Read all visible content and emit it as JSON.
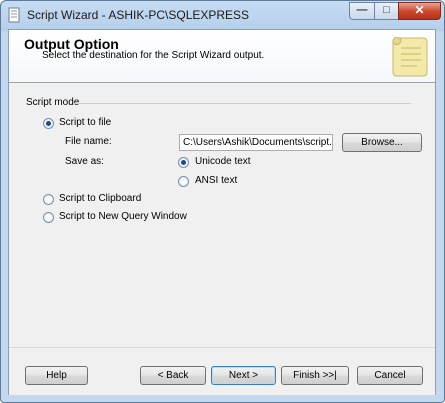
{
  "window": {
    "title": "Script Wizard - ASHIK-PC\\SQLEXPRESS",
    "minimize_glyph": "—",
    "maximize_glyph": "□",
    "close_glyph": "✕"
  },
  "header": {
    "title": "Output Option",
    "subtitle": "Select the destination for the Script Wizard output."
  },
  "script_mode": {
    "group_label": "Script mode",
    "options": [
      {
        "label": "Script to file",
        "selected": true
      },
      {
        "label": "Script to Clipboard",
        "selected": false
      },
      {
        "label": "Script to New Query Window",
        "selected": false
      }
    ],
    "file_name_label": "File name:",
    "file_name_value": "C:\\Users\\Ashik\\Documents\\script.s",
    "browse_label": "Browse...",
    "save_as_label": "Save as:",
    "save_as_options": [
      {
        "label": "Unicode text",
        "selected": true
      },
      {
        "label": "ANSI text",
        "selected": false
      }
    ]
  },
  "footer": {
    "help": "Help",
    "back": "< Back",
    "next": "Next >",
    "finish": "Finish >>|",
    "cancel": "Cancel"
  }
}
